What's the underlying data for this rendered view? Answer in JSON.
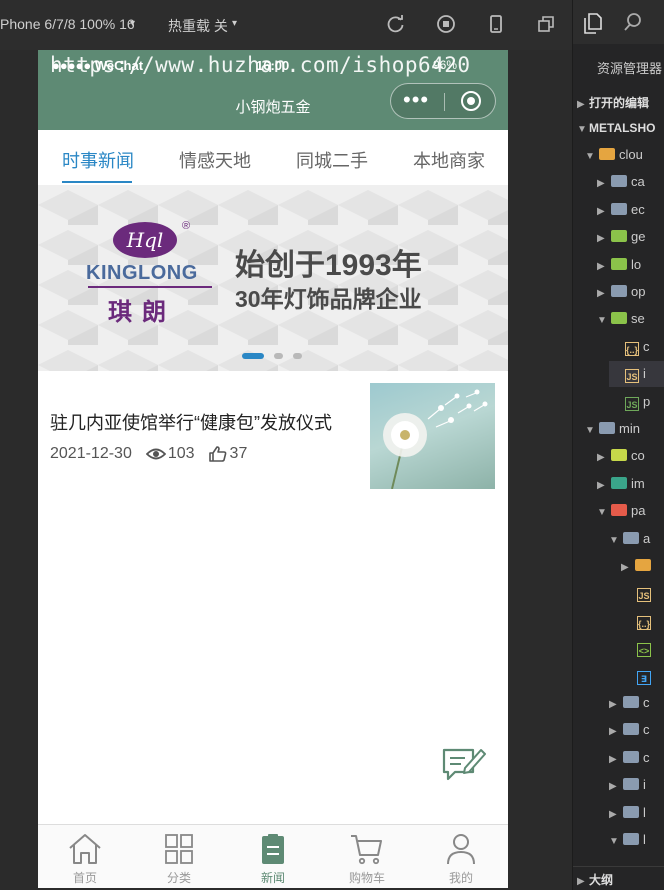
{
  "toolbar": {
    "device": "Phone 6/7/8 100% 16",
    "hot_reload": "热重载 关",
    "icons": [
      "refresh-icon",
      "stop-icon",
      "phone-icon",
      "window-icon"
    ]
  },
  "status_bar": {
    "carrier": "●●●●● WeChat",
    "time": "16:00",
    "battery": "96%"
  },
  "watermark": "https://www.huzhan.com/ishop6420",
  "nav": {
    "title": "小钢炮五金",
    "capsule_dots": "•••"
  },
  "tabs": [
    {
      "label": "时事新闻",
      "active": true
    },
    {
      "label": "情感天地",
      "active": false
    },
    {
      "label": "同城二手",
      "active": false
    },
    {
      "label": "本地商家",
      "active": false
    }
  ],
  "banner": {
    "logo_mark": "Hql",
    "brand": "KINGLONG",
    "brand_cn": "琪朗",
    "slogan1": "始创于1993年",
    "slogan2": "30年灯饰品牌企业",
    "active_index": 0,
    "count": 3
  },
  "news": [
    {
      "title": "驻几内亚使馆举行“健康包”发放仪式",
      "date": "2021-12-30",
      "views": "103",
      "likes": "37"
    }
  ],
  "tabbar": [
    {
      "label": "首页",
      "icon": "home-icon",
      "active": false
    },
    {
      "label": "分类",
      "icon": "category-icon",
      "active": false
    },
    {
      "label": "新闻",
      "icon": "news-icon",
      "active": true
    },
    {
      "label": "购物车",
      "icon": "cart-icon",
      "active": false
    },
    {
      "label": "我的",
      "icon": "user-icon",
      "active": false
    }
  ],
  "explorer": {
    "title": "资源管理器",
    "open_editors": "打开的编辑",
    "project": "METALSHO",
    "outline": "大纲",
    "rows": [
      {
        "label": "clou",
        "indent": 1,
        "open": true,
        "color": "#e5a540"
      },
      {
        "label": "ca",
        "indent": 2,
        "open": false,
        "color": "#8a9bb0"
      },
      {
        "label": "ec",
        "indent": 2,
        "open": false,
        "color": "#8a9bb0"
      },
      {
        "label": "ge",
        "indent": 2,
        "open": false,
        "color": "#8bc34a"
      },
      {
        "label": "lo",
        "indent": 2,
        "open": false,
        "color": "#8bc34a"
      },
      {
        "label": "op",
        "indent": 2,
        "open": false,
        "color": "#8a9bb0"
      },
      {
        "label": "se",
        "indent": 2,
        "open": true,
        "color": "#8bc34a"
      },
      {
        "label": "c",
        "indent": 3,
        "file": "{..}",
        "fcolor": "#e5c07b"
      },
      {
        "label": "i",
        "indent": 3,
        "file": "JS",
        "fcolor": "#e5c07b",
        "selected": true
      },
      {
        "label": "p",
        "indent": 3,
        "file": "JS",
        "fcolor": "#6fa85a"
      },
      {
        "label": "min",
        "indent": 1,
        "open": true,
        "color": "#8a9bb0"
      },
      {
        "label": "co",
        "indent": 2,
        "open": false,
        "color": "#c6d84a"
      },
      {
        "label": "im",
        "indent": 2,
        "open": false,
        "color": "#3aa58a"
      },
      {
        "label": "pa",
        "indent": 2,
        "open": true,
        "color": "#e55b4a"
      },
      {
        "label": "a",
        "indent": 3,
        "open": true,
        "color": "#8a9bb0"
      },
      {
        "label": "",
        "indent": 4,
        "open": false,
        "color": "#e5a540"
      },
      {
        "label": "",
        "indent": 4,
        "file": "JS",
        "fcolor": "#e5c07b"
      },
      {
        "label": "",
        "indent": 4,
        "file": "{..}",
        "fcolor": "#e5c07b"
      },
      {
        "label": "",
        "indent": 4,
        "file": "<>",
        "fcolor": "#8bc34a"
      },
      {
        "label": "",
        "indent": 4,
        "file": "∃",
        "fcolor": "#42a5f5"
      },
      {
        "label": "c",
        "indent": 3,
        "open": false,
        "color": "#8a9bb0"
      },
      {
        "label": "c",
        "indent": 3,
        "open": false,
        "color": "#8a9bb0"
      },
      {
        "label": "c",
        "indent": 3,
        "open": false,
        "color": "#8a9bb0"
      },
      {
        "label": "i",
        "indent": 3,
        "open": false,
        "color": "#8a9bb0"
      },
      {
        "label": "l",
        "indent": 3,
        "open": false,
        "color": "#8a9bb0"
      },
      {
        "label": "l",
        "indent": 3,
        "open": true,
        "color": "#8a9bb0"
      }
    ]
  }
}
